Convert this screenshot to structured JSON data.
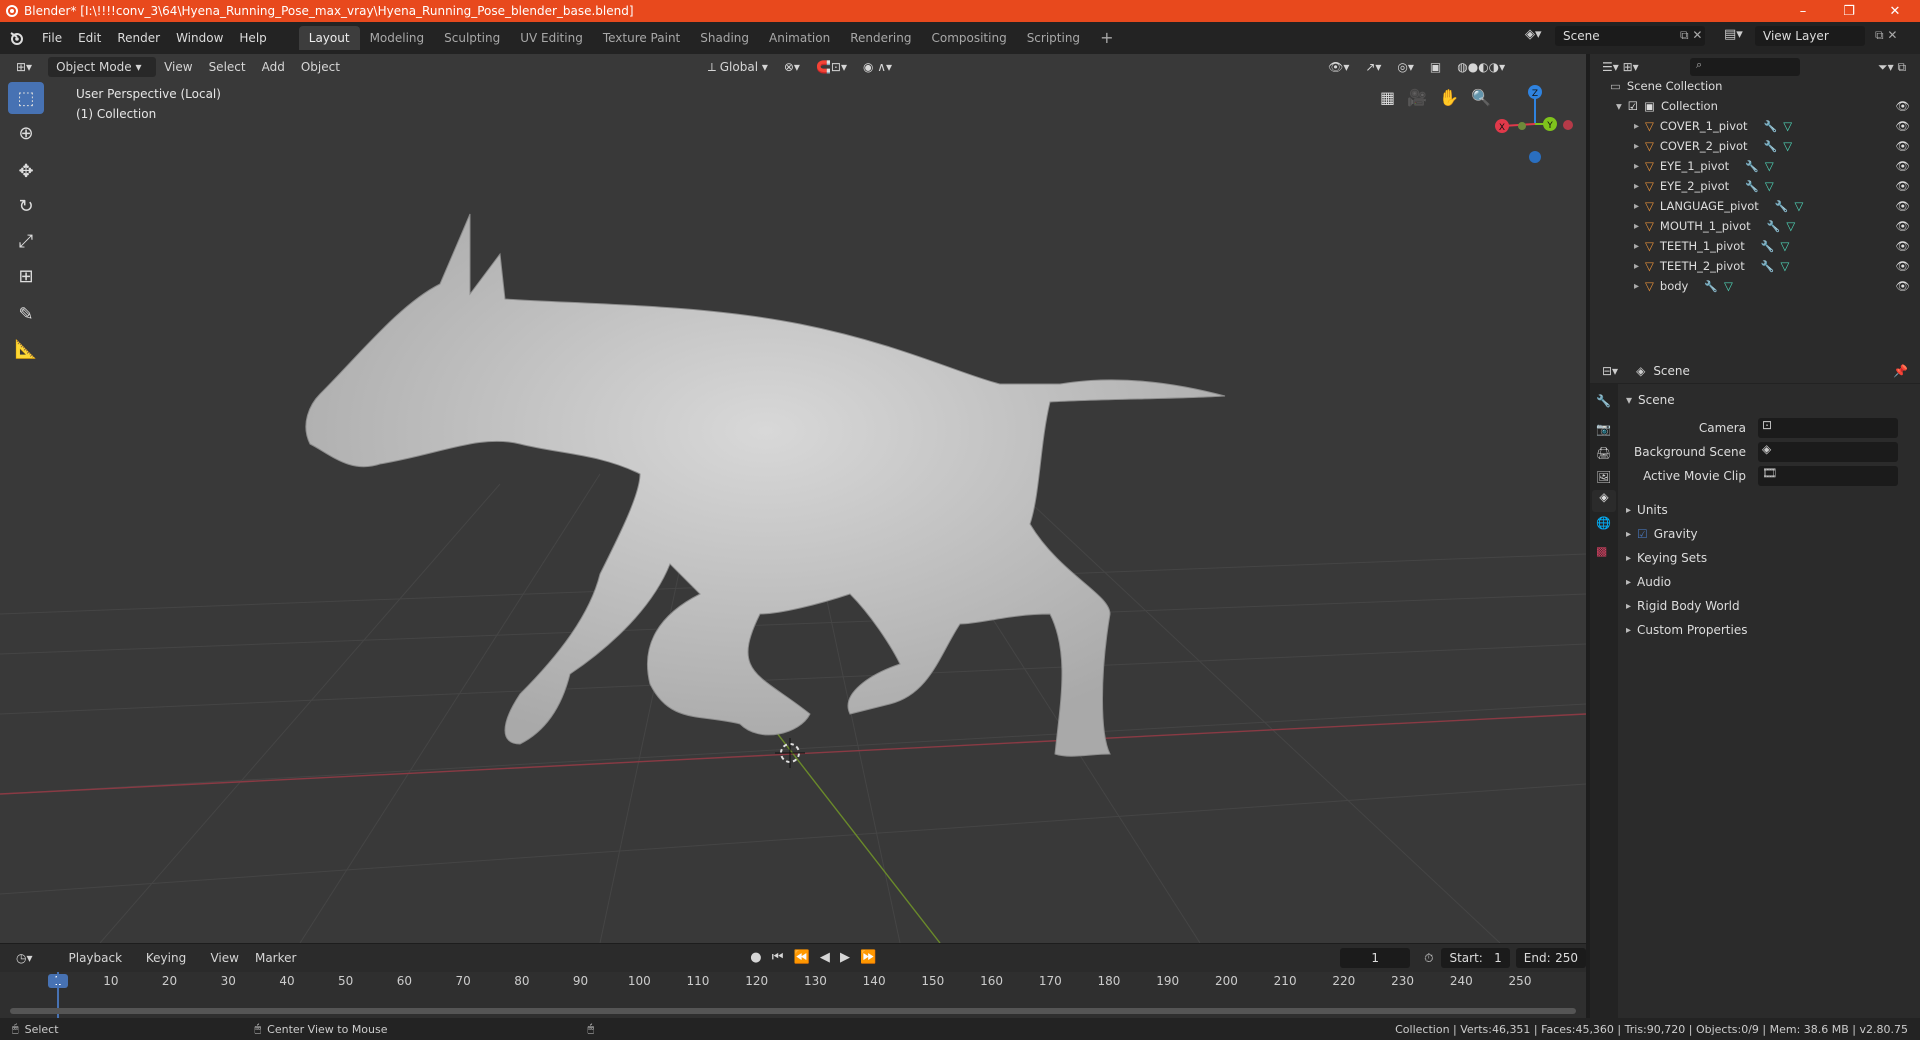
{
  "window": {
    "title": "Blender* [I:\\!!!!conv_3\\64\\Hyena_Running_Pose_max_vray\\Hyena_Running_Pose_blender_base.blend]",
    "controls": {
      "minimize": "–",
      "restore": "❐",
      "close": "✕"
    }
  },
  "menubar": {
    "menus": [
      "File",
      "Edit",
      "Render",
      "Window",
      "Help"
    ],
    "workspaces": [
      "Layout",
      "Modeling",
      "Sculpting",
      "UV Editing",
      "Texture Paint",
      "Shading",
      "Animation",
      "Rendering",
      "Compositing",
      "Scripting"
    ],
    "active_workspace": "Layout",
    "add_tab": "+",
    "scene": "Scene",
    "view_layer": "View Layer"
  },
  "viewport": {
    "mode": "Object Mode",
    "menus": [
      "View",
      "Select",
      "Add",
      "Object"
    ],
    "orientation": "Global",
    "info_line1": "User Perspective (Local)",
    "info_line2": "(1) Collection",
    "gizmo": {
      "x": "X",
      "y": "Y",
      "z": "Z"
    }
  },
  "outliner": {
    "root": "Scene Collection",
    "collection": "Collection",
    "items": [
      "COVER_1_pivot",
      "COVER_2_pivot",
      "EYE_1_pivot",
      "EYE_2_pivot",
      "LANGUAGE_pivot",
      "MOUTH_1_pivot",
      "TEETH_1_pivot",
      "TEETH_2_pivot",
      "body"
    ]
  },
  "properties": {
    "header": "Scene",
    "panel": "Scene",
    "camera_label": "Camera",
    "background_scene_label": "Background Scene",
    "active_movie_clip_label": "Active Movie Clip",
    "sections": [
      "Units",
      "Gravity",
      "Keying Sets",
      "Audio",
      "Rigid Body World",
      "Custom Properties"
    ],
    "gravity_checked": true
  },
  "timeline": {
    "menus": [
      "Playback",
      "Keying",
      "View",
      "Marker"
    ],
    "current_frame": "1",
    "start_label": "Start:",
    "start": "1",
    "end_label": "End:",
    "end": "250",
    "ticks": [
      "1",
      "10",
      "20",
      "30",
      "40",
      "50",
      "60",
      "70",
      "80",
      "90",
      "100",
      "110",
      "120",
      "130",
      "140",
      "150",
      "160",
      "170",
      "180",
      "190",
      "200",
      "210",
      "220",
      "230",
      "240",
      "250"
    ]
  },
  "statusbar": {
    "select": "Select",
    "center_view": "Center View to Mouse",
    "stats": "Collection | Verts:46,351 | Faces:45,360 | Tris:90,720 | Objects:0/9 | Mem: 38.6 MB | v2.80.75"
  },
  "colors": {
    "title_bar": "#e8491d",
    "accent": "#4772b3",
    "x_axis": "#e0394a",
    "y_axis": "#7fc31c",
    "z_axis": "#2f83e0",
    "object_orange": "#e8913a",
    "mesh_green": "#4fd6b8"
  }
}
